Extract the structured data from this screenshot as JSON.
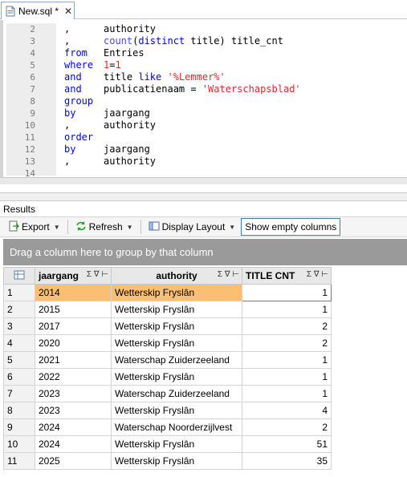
{
  "tab": {
    "label": "New.sql *",
    "close": "✕"
  },
  "editor": {
    "lines": [
      {
        "n": "2",
        "a": ",",
        "b": "authority",
        "type": "plain"
      },
      {
        "n": "3",
        "a": ",",
        "b": "count(distinct title) title_cnt",
        "type": "count"
      },
      {
        "n": "4",
        "a": "from",
        "b": "Entries",
        "type": "kw"
      },
      {
        "n": "5",
        "a": "where",
        "b": "1=1",
        "type": "where"
      },
      {
        "n": "6",
        "a": "and",
        "b": "title like '%Lemmer%'",
        "type": "like"
      },
      {
        "n": "7",
        "a": "and",
        "b": "publicatienaam = 'Waterschapsblad'",
        "type": "eq"
      },
      {
        "n": "8",
        "a": "group",
        "b": "",
        "type": "kw"
      },
      {
        "n": "9",
        "a": "by",
        "b": "jaargang",
        "type": "kw"
      },
      {
        "n": "10",
        "a": ",",
        "b": "authority",
        "type": "plain"
      },
      {
        "n": "11",
        "a": "order",
        "b": "",
        "type": "kw"
      },
      {
        "n": "12",
        "a": "by",
        "b": "jaargang",
        "type": "kw"
      },
      {
        "n": "13",
        "a": ",",
        "b": "authority",
        "type": "plain"
      },
      {
        "n": "14",
        "a": "",
        "b": "",
        "type": "plain"
      }
    ]
  },
  "results": {
    "title": "Results",
    "toolbar": {
      "export": "Export",
      "refresh": "Refresh",
      "display_layout": "Display Layout",
      "show_empty": "Show empty columns"
    },
    "group_hint": "Drag a column here to group by that column",
    "columns": [
      "jaargang",
      "authority",
      "TITLE CNT"
    ],
    "header_icons": "Σ ∇ ⊢",
    "rows": [
      {
        "n": "1",
        "year": "2014",
        "authority": "Wetterskip Fryslân",
        "cnt": "1"
      },
      {
        "n": "2",
        "year": "2015",
        "authority": "Wetterskip Fryslân",
        "cnt": "1"
      },
      {
        "n": "3",
        "year": "2017",
        "authority": "Wetterskip Fryslân",
        "cnt": "2"
      },
      {
        "n": "4",
        "year": "2020",
        "authority": "Wetterskip Fryslân",
        "cnt": "2"
      },
      {
        "n": "5",
        "year": "2021",
        "authority": "Waterschap Zuiderzeeland",
        "cnt": "1"
      },
      {
        "n": "6",
        "year": "2022",
        "authority": "Wetterskip Fryslân",
        "cnt": "1"
      },
      {
        "n": "7",
        "year": "2023",
        "authority": "Waterschap Zuiderzeeland",
        "cnt": "1"
      },
      {
        "n": "8",
        "year": "2023",
        "authority": "Wetterskip Fryslân",
        "cnt": "4"
      },
      {
        "n": "9",
        "year": "2024",
        "authority": "Waterschap Noorderzijlvest",
        "cnt": "2"
      },
      {
        "n": "10",
        "year": "2024",
        "authority": "Wetterskip Fryslân",
        "cnt": "51"
      },
      {
        "n": "11",
        "year": "2025",
        "authority": "Wetterskip Fryslân",
        "cnt": "35"
      }
    ],
    "selected_row": "1"
  },
  "colors": {
    "keyword": "#0000ff",
    "string": "#e0282a",
    "selection": "#fbbf73",
    "group_panel": "#9a9a9a"
  }
}
